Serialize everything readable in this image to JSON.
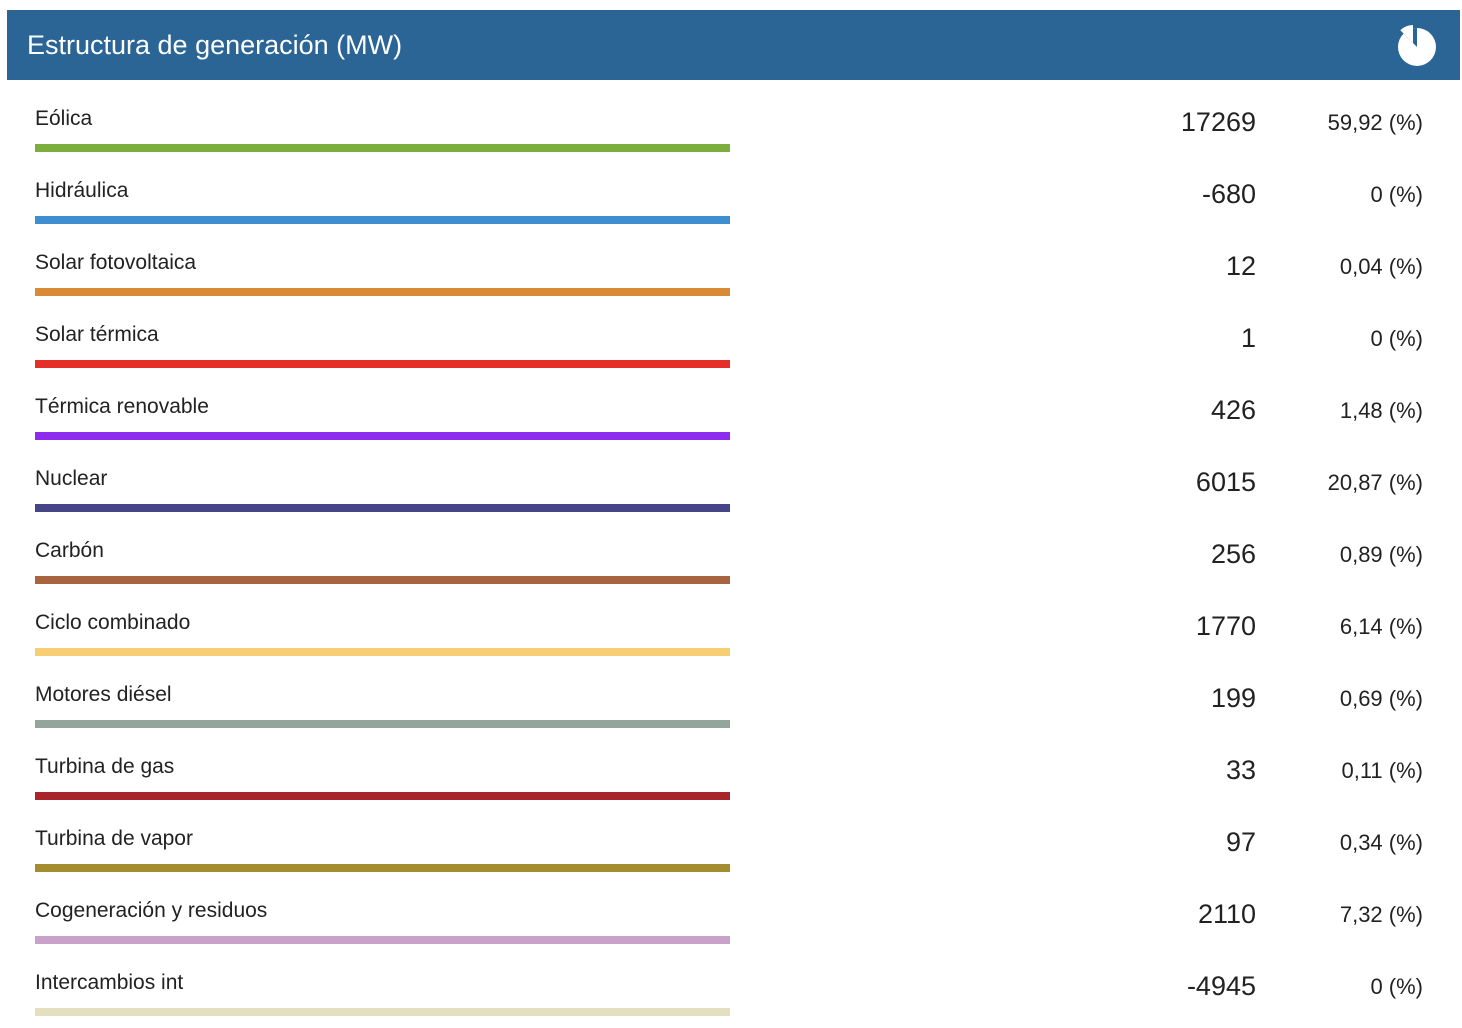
{
  "header": {
    "title": "Estructura de generación (MW)",
    "background_color": "#2a6596",
    "pie_icon": "pie-chart-icon"
  },
  "rows": [
    {
      "label": "Eólica",
      "value": "17269",
      "percent": "59,92 (%)",
      "color": "#7cae3e"
    },
    {
      "label": "Hidráulica",
      "value": "-680",
      "percent": "0 (%)",
      "color": "#3f8fd0"
    },
    {
      "label": "Solar fotovoltaica",
      "value": "12",
      "percent": "0,04 (%)",
      "color": "#d98a35"
    },
    {
      "label": "Solar térmica",
      "value": "1",
      "percent": "0 (%)",
      "color": "#e5302a"
    },
    {
      "label": "Térmica renovable",
      "value": "426",
      "percent": "1,48 (%)",
      "color": "#8d2bee"
    },
    {
      "label": "Nuclear",
      "value": "6015",
      "percent": "20,87 (%)",
      "color": "#464588"
    },
    {
      "label": "Carbón",
      "value": "256",
      "percent": "0,89 (%)",
      "color": "#a7643e"
    },
    {
      "label": "Ciclo combinado",
      "value": "1770",
      "percent": "6,14 (%)",
      "color": "#f7ce74"
    },
    {
      "label": "Motores diésel",
      "value": "199",
      "percent": "0,69 (%)",
      "color": "#94a59e"
    },
    {
      "label": "Turbina de gas",
      "value": "33",
      "percent": "0,11 (%)",
      "color": "#a8262a"
    },
    {
      "label": "Turbina de vapor",
      "value": "97",
      "percent": "0,34 (%)",
      "color": "#a48d2e"
    },
    {
      "label": "Cogeneración y residuos",
      "value": "2110",
      "percent": "7,32 (%)",
      "color": "#c8a2c8"
    },
    {
      "label": "Intercambios int",
      "value": "-4945",
      "percent": "0 (%)",
      "color": "#e4e0bf"
    }
  ]
}
